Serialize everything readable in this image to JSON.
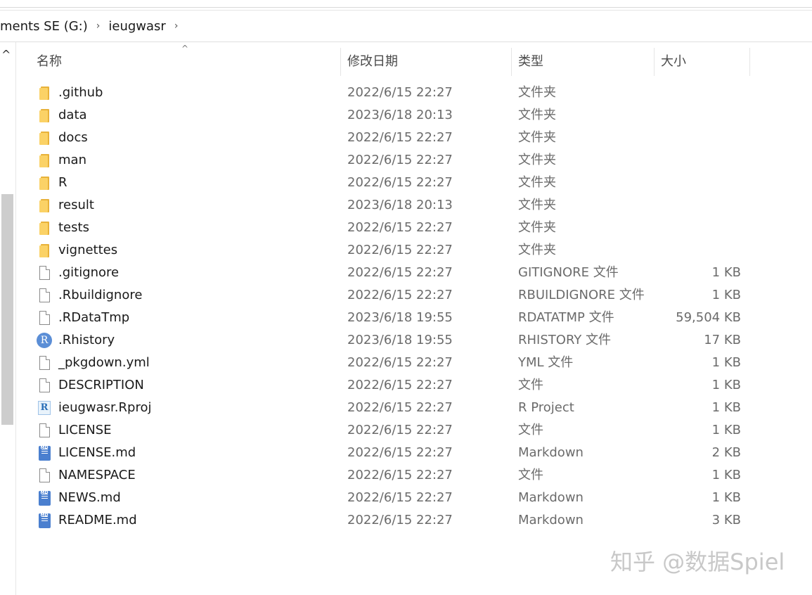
{
  "address_bar": {
    "segments": [
      "ments SE (G:)",
      "ieugwasr"
    ],
    "separator": "›"
  },
  "scrollbar": {
    "up_glyph": "^"
  },
  "columns": {
    "name": "名称",
    "date": "修改日期",
    "type": "类型",
    "size": "大小",
    "sort_indicator": "^"
  },
  "files": [
    {
      "name": ".github",
      "date": "2022/6/15 22:27",
      "type": "文件夹",
      "size": "",
      "icon": "folder-icon"
    },
    {
      "name": "data",
      "date": "2023/6/18 20:13",
      "type": "文件夹",
      "size": "",
      "icon": "folder-icon"
    },
    {
      "name": "docs",
      "date": "2022/6/15 22:27",
      "type": "文件夹",
      "size": "",
      "icon": "folder-icon"
    },
    {
      "name": "man",
      "date": "2022/6/15 22:27",
      "type": "文件夹",
      "size": "",
      "icon": "folder-icon"
    },
    {
      "name": "R",
      "date": "2022/6/15 22:27",
      "type": "文件夹",
      "size": "",
      "icon": "folder-icon"
    },
    {
      "name": "result",
      "date": "2023/6/18 20:13",
      "type": "文件夹",
      "size": "",
      "icon": "folder-icon"
    },
    {
      "name": "tests",
      "date": "2022/6/15 22:27",
      "type": "文件夹",
      "size": "",
      "icon": "folder-icon"
    },
    {
      "name": "vignettes",
      "date": "2022/6/15 22:27",
      "type": "文件夹",
      "size": "",
      "icon": "folder-icon"
    },
    {
      "name": ".gitignore",
      "date": "2022/6/15 22:27",
      "type": "GITIGNORE 文件",
      "size": "1 KB",
      "icon": "file-icon"
    },
    {
      "name": ".Rbuildignore",
      "date": "2022/6/15 22:27",
      "type": "RBUILDIGNORE 文件",
      "size": "1 KB",
      "icon": "file-icon"
    },
    {
      "name": ".RDataTmp",
      "date": "2023/6/18 19:55",
      "type": "RDATATMP 文件",
      "size": "59,504 KB",
      "icon": "file-icon"
    },
    {
      "name": ".Rhistory",
      "date": "2023/6/18 19:55",
      "type": "RHISTORY 文件",
      "size": "17 KB",
      "icon": "r-history-icon"
    },
    {
      "name": "_pkgdown.yml",
      "date": "2022/6/15 22:27",
      "type": "YML 文件",
      "size": "1 KB",
      "icon": "file-icon"
    },
    {
      "name": "DESCRIPTION",
      "date": "2022/6/15 22:27",
      "type": "文件",
      "size": "1 KB",
      "icon": "file-icon"
    },
    {
      "name": "ieugwasr.Rproj",
      "date": "2022/6/15 22:27",
      "type": "R Project",
      "size": "1 KB",
      "icon": "r-project-icon"
    },
    {
      "name": "LICENSE",
      "date": "2022/6/15 22:27",
      "type": "文件",
      "size": "1 KB",
      "icon": "file-icon"
    },
    {
      "name": "LICENSE.md",
      "date": "2022/6/15 22:27",
      "type": "Markdown",
      "size": "2 KB",
      "icon": "markdown-icon"
    },
    {
      "name": "NAMESPACE",
      "date": "2022/6/15 22:27",
      "type": "文件",
      "size": "1 KB",
      "icon": "file-icon"
    },
    {
      "name": "NEWS.md",
      "date": "2022/6/15 22:27",
      "type": "Markdown",
      "size": "1 KB",
      "icon": "markdown-icon"
    },
    {
      "name": "README.md",
      "date": "2022/6/15 22:27",
      "type": "Markdown",
      "size": "3 KB",
      "icon": "markdown-icon"
    }
  ],
  "icon_letters": {
    "r": "R",
    "md": "MD"
  },
  "watermark": "知乎 @数据Spiel",
  "colors": {
    "folder": "#fbd266",
    "markdown": "#4a7fcf",
    "r_blue": "#5b8ed6"
  }
}
